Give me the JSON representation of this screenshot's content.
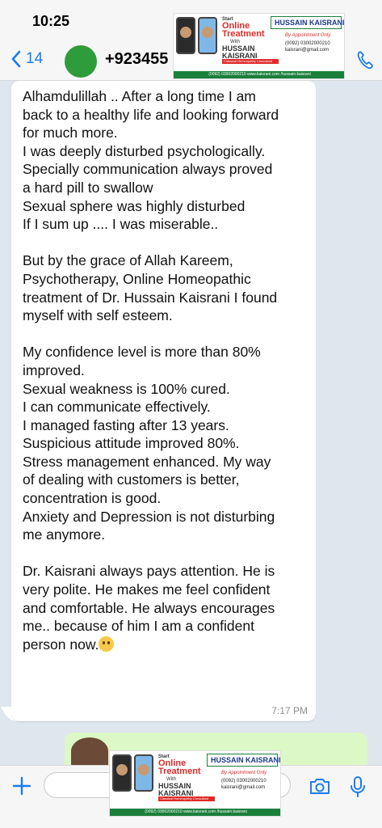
{
  "status_bar": {
    "time": "10:25"
  },
  "header": {
    "back_count": "14",
    "contact_name": "+923455",
    "icons": {
      "back": "chevron-left-icon",
      "call": "phone-icon"
    }
  },
  "ad": {
    "start": "Start",
    "online_treatment": "Online Treatment",
    "with": "With",
    "name_line1": "HUSSAIN",
    "name_line2": "KAISRANI",
    "classical": "Classical Homeopathy Consultant",
    "brand": "HUSSAIN KAISRANI",
    "appointment": "By Appointment Only",
    "phone": "(0092) 03002000210",
    "email": "kaisrani@gmail.com",
    "footer": "(0092) 03002000210 www.kaisrani.com /hussain.kaisrani"
  },
  "message": {
    "paragraphs": [
      [
        "Alhamdulillah .. After a long time I am",
        "back to a healthy life and looking forward",
        "for much more.",
        "I was deeply disturbed psychologically.",
        "Specially communication always proved",
        "a hard pill to swallow",
        "Sexual sphere was highly disturbed",
        "If I sum up .... I was miserable.."
      ],
      [
        "But by the grace of Allah Kareem,",
        "Psychotherapy, Online Homeopathic",
        "treatment of Dr. Hussain Kaisrani I found",
        "myself with self esteem."
      ],
      [
        "My confidence level is more than 80%",
        "improved.",
        "Sexual weakness is 100% cured.",
        "I can communicate effectively.",
        "I managed fasting after 13 years.",
        "Suspicious attitude improved 80%.",
        "Stress management enhanced. My way",
        "of dealing with customers is better,",
        "concentration is good.",
        "Anxiety and Depression is not disturbing",
        "me anymore."
      ],
      [
        "Dr. Kaisrani always pays attention. He is",
        "very polite. He makes me feel confident",
        "and comfortable. He always encourages",
        "me.. because of him I am  a confident",
        "person now."
      ]
    ],
    "time": "7:17 PM",
    "emoji": "smiley-emoji-icon"
  },
  "input_bar": {
    "icons": {
      "plus": "plus-icon",
      "camera": "camera-icon",
      "mic": "microphone-icon"
    },
    "placeholder": ""
  },
  "colors": {
    "accent": "#1a7cf0",
    "background": "#dfe6ee",
    "incoming_bubble": "#ffffff",
    "outgoing_bubble": "#dcf8c6"
  }
}
